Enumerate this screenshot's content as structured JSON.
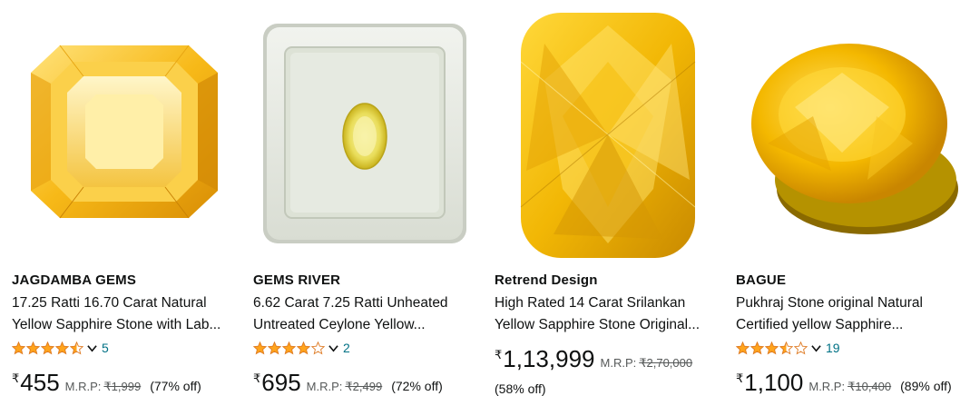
{
  "products": [
    {
      "brand": "JAGDAMBA GEMS",
      "title_line1": "17.25 Ratti 16.70 Carat Natural",
      "title_line2": "Yellow Sapphire Stone with Lab...",
      "rating": 4.5,
      "rating_count": "5",
      "currency": "₹",
      "price": "455",
      "mrp_label": "M.R.P:",
      "mrp": "₹1,999",
      "discount": "(77% off)",
      "image": "emerald-cut-yellow-sapphire"
    },
    {
      "brand": "GEMS RIVER",
      "title_line1": "6.62 Carat 7.25 Ratti Unheated",
      "title_line2": "Untreated Ceylone Yellow...",
      "rating": 4,
      "rating_count": "2",
      "currency": "₹",
      "price": "695",
      "mrp_label": "M.R.P:",
      "mrp": "₹2,499",
      "discount": "(72% off)",
      "image": "oval-sapphire-in-gem-box"
    },
    {
      "brand": "Retrend Design",
      "title_line1": "High Rated 14 Carat Srilankan",
      "title_line2": "Yellow Sapphire Stone Original...",
      "currency": "₹",
      "price": "1,13,999",
      "mrp_label": "M.R.P:",
      "mrp": "₹2,70,000",
      "discount": "(58% off)",
      "image": "cushion-cut-yellow-sapphire"
    },
    {
      "brand": "BAGUE",
      "title_line1": "Pukhraj Stone original Natural",
      "title_line2": "Certified yellow Sapphire...",
      "rating": 3.5,
      "rating_count": "19",
      "currency": "₹",
      "price": "1,100",
      "mrp_label": "M.R.P:",
      "mrp": "₹10,400",
      "discount": "(89% off)",
      "image": "oval-yellow-sapphire"
    }
  ],
  "colors": {
    "star": "#FFA41C",
    "link": "#007185",
    "text": "#0F1111",
    "muted": "#565959"
  }
}
